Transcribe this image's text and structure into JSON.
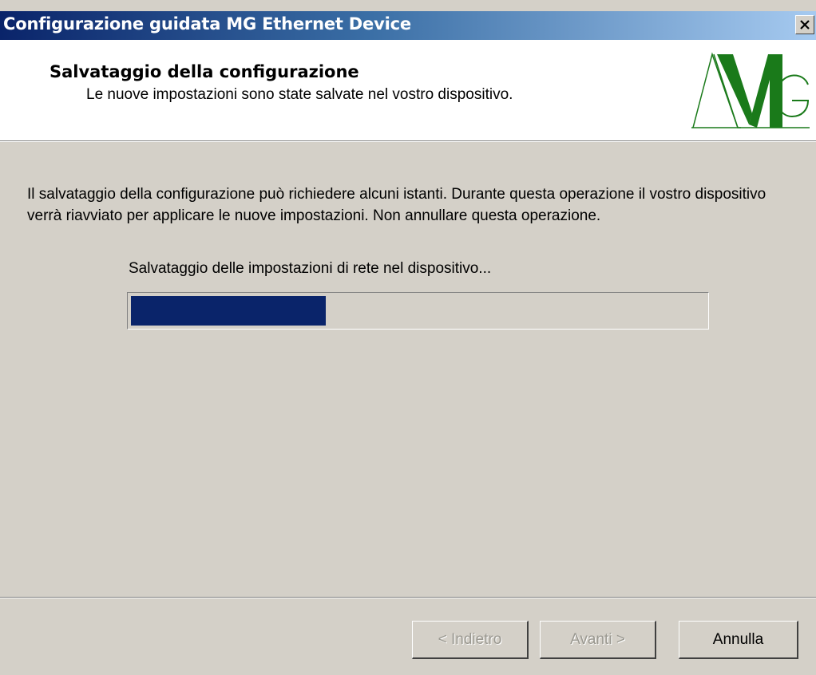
{
  "window": {
    "title": "Configurazione guidata MG Ethernet Device",
    "close_glyph": "×"
  },
  "header": {
    "title": "Salvataggio della configurazione",
    "subtitle": "Le nuove impostazioni sono state salvate nel vostro dispositivo.",
    "logo": {
      "icon": "mg-logo",
      "color": "#1a7a1a"
    }
  },
  "content": {
    "description": "Il salvataggio della configurazione può richiedere alcuni istanti.  Durante questa operazione il vostro dispositivo verrà riavviato per applicare le nuove impostazioni.  Non annullare questa operazione.",
    "status": "Salvataggio delle impostazioni di rete nel dispositivo...",
    "progress_fraction": 0.34,
    "progress_color": "#0a246a"
  },
  "buttons": {
    "back": {
      "label": "< Indietro",
      "enabled": false
    },
    "next": {
      "label": "Avanti >",
      "enabled": false
    },
    "cancel": {
      "label": "Annulla",
      "enabled": true
    }
  }
}
